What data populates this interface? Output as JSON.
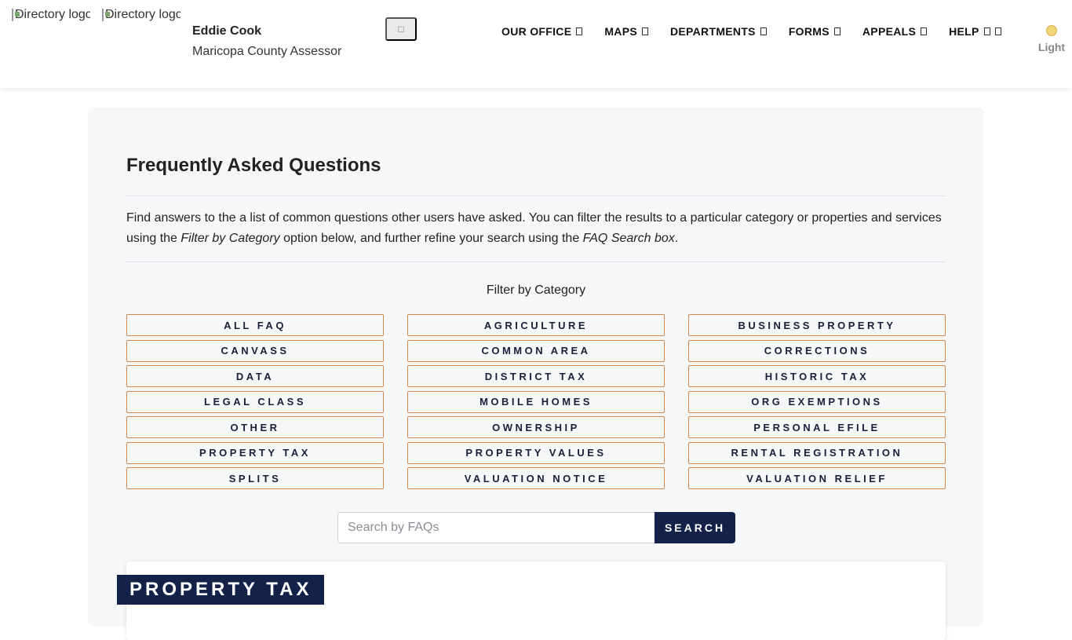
{
  "header": {
    "logo_alt_1": "Directory logo",
    "logo_alt_2": "Directory logo",
    "assessor_name": "Eddie Cook",
    "assessor_title": "Maricopa County Assessor",
    "search_icon": "search-icon",
    "nav": [
      {
        "label": "OUR OFFICE"
      },
      {
        "label": "MAPS"
      },
      {
        "label": "DEPARTMENTS"
      },
      {
        "label": "FORMS"
      },
      {
        "label": "APPEALS"
      },
      {
        "label": "HELP"
      }
    ],
    "theme_label": "Light"
  },
  "faq": {
    "title": "Frequently Asked Questions",
    "intro_part1": "Find answers to the a list of common questions other users have asked. You can filter the results to a particular category or properties and services using the ",
    "intro_em1": "Filter by Category",
    "intro_part2": " option below, and further refine your search using the ",
    "intro_em2": "FAQ Search box",
    "intro_part3": ".",
    "filter_label": "Filter by Category",
    "categories": [
      "ALL FAQ",
      "AGRICULTURE",
      "BUSINESS PROPERTY",
      "CANVASS",
      "COMMON AREA",
      "CORRECTIONS",
      "DATA",
      "DISTRICT TAX",
      "HISTORIC TAX",
      "LEGAL CLASS",
      "MOBILE HOMES",
      "ORG EXEMPTIONS",
      "OTHER",
      "OWNERSHIP",
      "PERSONAL EFILE",
      "PROPERTY TAX",
      "PROPERTY VALUES",
      "RENTAL REGISTRATION",
      "SPLITS",
      "VALUATION NOTICE",
      "VALUATION RELIEF"
    ],
    "search_placeholder": "Search by FAQs",
    "search_button": "SEARCH",
    "section_title": "PROPERTY TAX"
  },
  "colors": {
    "navy": "#14224a",
    "category_border": "#d4874d",
    "panel_bg": "#f6f7f9"
  }
}
